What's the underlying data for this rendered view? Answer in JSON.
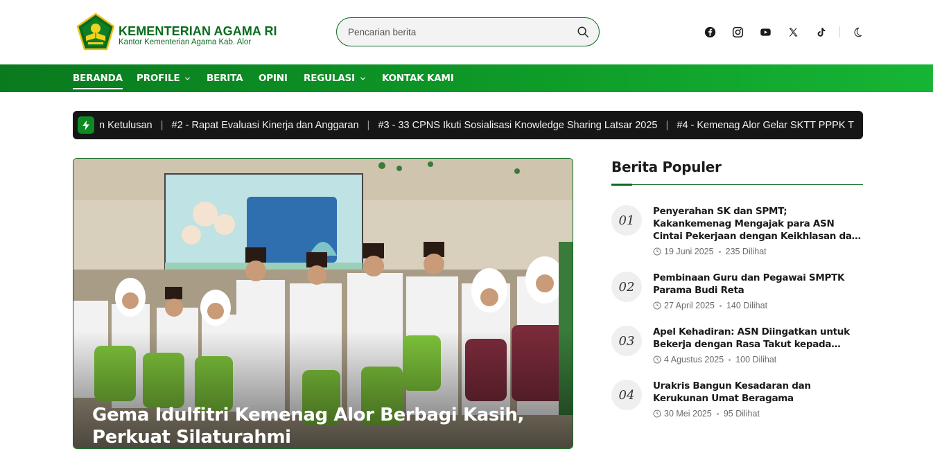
{
  "brand": {
    "title": "KEMENTERIAN AGAMA RI",
    "subtitle": "Kantor Kementerian Agama Kab. Alor"
  },
  "search": {
    "placeholder": "Pencarian berita",
    "icon": "search-icon"
  },
  "social": [
    "facebook-icon",
    "instagram-icon",
    "youtube-icon",
    "x-twitter-icon",
    "tiktok-icon"
  ],
  "theme_toggle_icon": "moon-icon",
  "nav": {
    "items": [
      {
        "label": "BERANDA",
        "active": true,
        "has_dropdown": false
      },
      {
        "label": "PROFILE",
        "active": false,
        "has_dropdown": true
      },
      {
        "label": "BERITA",
        "active": false,
        "has_dropdown": false
      },
      {
        "label": "OPINI",
        "active": false,
        "has_dropdown": false
      },
      {
        "label": "REGULASI",
        "active": false,
        "has_dropdown": true
      },
      {
        "label": "KONTAK KAMI",
        "active": false,
        "has_dropdown": false
      }
    ]
  },
  "ticker": {
    "icon": "lightning-icon",
    "items": [
      "n Ketulusan",
      "#2 - Rapat Evaluasi Kinerja dan Anggaran",
      "#3 - 33 CPNS Ikuti Sosialisasi Knowledge Sharing Latsar 2025",
      "#4 - Kemenag Alor Gelar SKTT PPPK T"
    ]
  },
  "featured": {
    "title": "Gema Idulfitri Kemenag Alor Berbagi Kasih, Perkuat Silaturahmi"
  },
  "popular": {
    "heading": "Berita Populer",
    "items": [
      {
        "num": "01",
        "title": "Penyerahan SK dan SPMT; Kakankemenag Mengajak para ASN Cintai Pekerjaan dengan Keikhlasan dan Tanggung Jawab",
        "date": "19 Juni 2025",
        "views": "235 Dilihat"
      },
      {
        "num": "02",
        "title": "Pembinaan Guru dan Pegawai SMPTK Parama Budi Reta",
        "date": "27 April 2025",
        "views": "140 Dilihat"
      },
      {
        "num": "03",
        "title": "Apel Kehadiran: ASN Diingatkan untuk Bekerja dengan Rasa Takut kepada Tuhan",
        "date": "4 Agustus 2025",
        "views": "100 Dilihat"
      },
      {
        "num": "04",
        "title": "Urakris Bangun Kesadaran dan Kerukunan Umat Beragama",
        "date": "30 Mei 2025",
        "views": "95 Dilihat"
      }
    ]
  },
  "colors": {
    "brand_green": "#0b6b1e",
    "nav_green": "#0e9a28",
    "ticker_bg": "#161616"
  }
}
